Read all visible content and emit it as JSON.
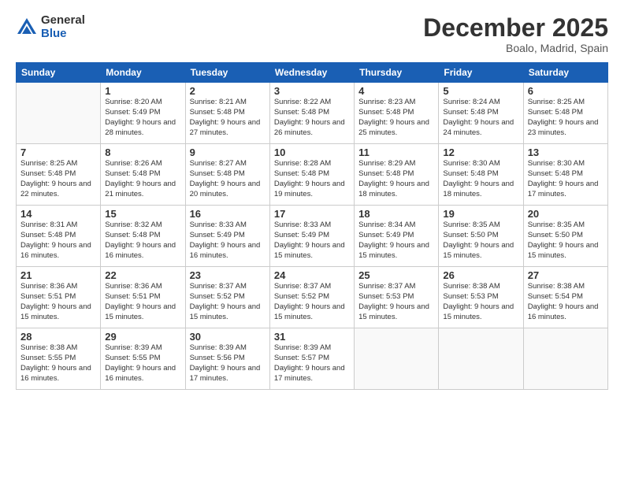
{
  "logo": {
    "general": "General",
    "blue": "Blue"
  },
  "title": "December 2025",
  "subtitle": "Boalo, Madrid, Spain",
  "days_of_week": [
    "Sunday",
    "Monday",
    "Tuesday",
    "Wednesday",
    "Thursday",
    "Friday",
    "Saturday"
  ],
  "weeks": [
    [
      {
        "num": "",
        "info": ""
      },
      {
        "num": "1",
        "info": "Sunrise: 8:20 AM\nSunset: 5:49 PM\nDaylight: 9 hours\nand 28 minutes."
      },
      {
        "num": "2",
        "info": "Sunrise: 8:21 AM\nSunset: 5:48 PM\nDaylight: 9 hours\nand 27 minutes."
      },
      {
        "num": "3",
        "info": "Sunrise: 8:22 AM\nSunset: 5:48 PM\nDaylight: 9 hours\nand 26 minutes."
      },
      {
        "num": "4",
        "info": "Sunrise: 8:23 AM\nSunset: 5:48 PM\nDaylight: 9 hours\nand 25 minutes."
      },
      {
        "num": "5",
        "info": "Sunrise: 8:24 AM\nSunset: 5:48 PM\nDaylight: 9 hours\nand 24 minutes."
      },
      {
        "num": "6",
        "info": "Sunrise: 8:25 AM\nSunset: 5:48 PM\nDaylight: 9 hours\nand 23 minutes."
      }
    ],
    [
      {
        "num": "7",
        "info": "Sunrise: 8:25 AM\nSunset: 5:48 PM\nDaylight: 9 hours\nand 22 minutes."
      },
      {
        "num": "8",
        "info": "Sunrise: 8:26 AM\nSunset: 5:48 PM\nDaylight: 9 hours\nand 21 minutes."
      },
      {
        "num": "9",
        "info": "Sunrise: 8:27 AM\nSunset: 5:48 PM\nDaylight: 9 hours\nand 20 minutes."
      },
      {
        "num": "10",
        "info": "Sunrise: 8:28 AM\nSunset: 5:48 PM\nDaylight: 9 hours\nand 19 minutes."
      },
      {
        "num": "11",
        "info": "Sunrise: 8:29 AM\nSunset: 5:48 PM\nDaylight: 9 hours\nand 18 minutes."
      },
      {
        "num": "12",
        "info": "Sunrise: 8:30 AM\nSunset: 5:48 PM\nDaylight: 9 hours\nand 18 minutes."
      },
      {
        "num": "13",
        "info": "Sunrise: 8:30 AM\nSunset: 5:48 PM\nDaylight: 9 hours\nand 17 minutes."
      }
    ],
    [
      {
        "num": "14",
        "info": "Sunrise: 8:31 AM\nSunset: 5:48 PM\nDaylight: 9 hours\nand 16 minutes."
      },
      {
        "num": "15",
        "info": "Sunrise: 8:32 AM\nSunset: 5:48 PM\nDaylight: 9 hours\nand 16 minutes."
      },
      {
        "num": "16",
        "info": "Sunrise: 8:33 AM\nSunset: 5:49 PM\nDaylight: 9 hours\nand 16 minutes."
      },
      {
        "num": "17",
        "info": "Sunrise: 8:33 AM\nSunset: 5:49 PM\nDaylight: 9 hours\nand 15 minutes."
      },
      {
        "num": "18",
        "info": "Sunrise: 8:34 AM\nSunset: 5:49 PM\nDaylight: 9 hours\nand 15 minutes."
      },
      {
        "num": "19",
        "info": "Sunrise: 8:35 AM\nSunset: 5:50 PM\nDaylight: 9 hours\nand 15 minutes."
      },
      {
        "num": "20",
        "info": "Sunrise: 8:35 AM\nSunset: 5:50 PM\nDaylight: 9 hours\nand 15 minutes."
      }
    ],
    [
      {
        "num": "21",
        "info": "Sunrise: 8:36 AM\nSunset: 5:51 PM\nDaylight: 9 hours\nand 15 minutes."
      },
      {
        "num": "22",
        "info": "Sunrise: 8:36 AM\nSunset: 5:51 PM\nDaylight: 9 hours\nand 15 minutes."
      },
      {
        "num": "23",
        "info": "Sunrise: 8:37 AM\nSunset: 5:52 PM\nDaylight: 9 hours\nand 15 minutes."
      },
      {
        "num": "24",
        "info": "Sunrise: 8:37 AM\nSunset: 5:52 PM\nDaylight: 9 hours\nand 15 minutes."
      },
      {
        "num": "25",
        "info": "Sunrise: 8:37 AM\nSunset: 5:53 PM\nDaylight: 9 hours\nand 15 minutes."
      },
      {
        "num": "26",
        "info": "Sunrise: 8:38 AM\nSunset: 5:53 PM\nDaylight: 9 hours\nand 15 minutes."
      },
      {
        "num": "27",
        "info": "Sunrise: 8:38 AM\nSunset: 5:54 PM\nDaylight: 9 hours\nand 16 minutes."
      }
    ],
    [
      {
        "num": "28",
        "info": "Sunrise: 8:38 AM\nSunset: 5:55 PM\nDaylight: 9 hours\nand 16 minutes."
      },
      {
        "num": "29",
        "info": "Sunrise: 8:39 AM\nSunset: 5:55 PM\nDaylight: 9 hours\nand 16 minutes."
      },
      {
        "num": "30",
        "info": "Sunrise: 8:39 AM\nSunset: 5:56 PM\nDaylight: 9 hours\nand 17 minutes."
      },
      {
        "num": "31",
        "info": "Sunrise: 8:39 AM\nSunset: 5:57 PM\nDaylight: 9 hours\nand 17 minutes."
      },
      {
        "num": "",
        "info": ""
      },
      {
        "num": "",
        "info": ""
      },
      {
        "num": "",
        "info": ""
      }
    ]
  ]
}
